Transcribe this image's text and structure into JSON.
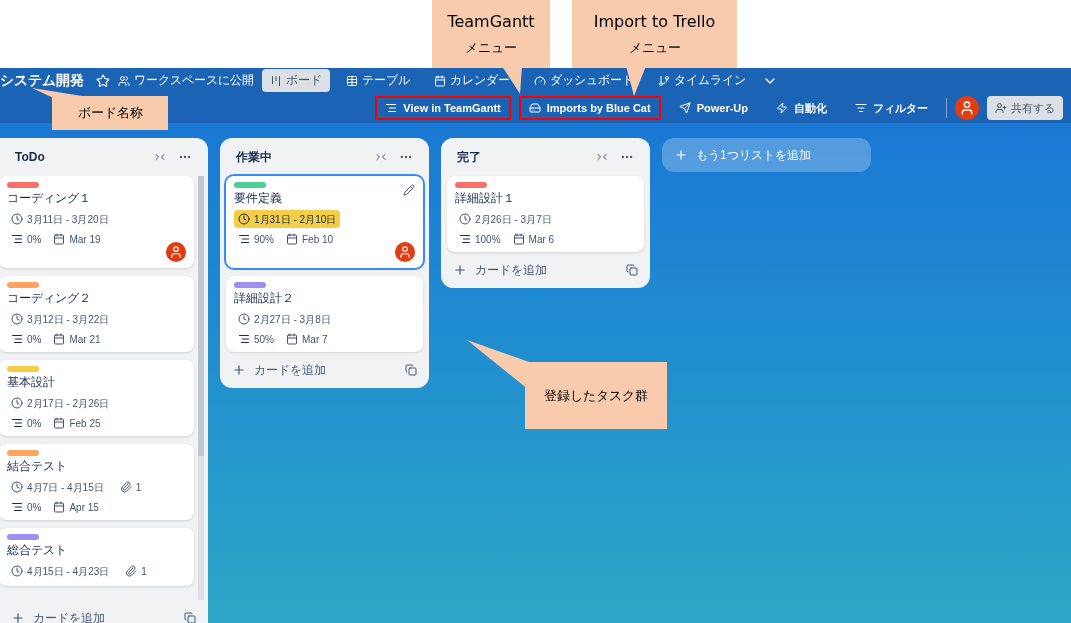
{
  "board": {
    "title": "システム開発",
    "visibility": "ワークスペースに公開"
  },
  "views": [
    {
      "label": "ボード",
      "selected": true
    },
    {
      "label": "テーブル",
      "selected": false
    },
    {
      "label": "カレンダー",
      "selected": false
    },
    {
      "label": "ダッシュボード",
      "selected": false
    },
    {
      "label": "タイムライン",
      "selected": false
    }
  ],
  "toolbar": [
    {
      "label": "View in TeamGantt",
      "highlighted": true
    },
    {
      "label": "Imports by Blue Cat",
      "highlighted": true
    },
    {
      "label": "Power-Up",
      "highlighted": false
    },
    {
      "label": "自動化",
      "highlighted": false
    },
    {
      "label": "フィルター",
      "highlighted": false
    }
  ],
  "share": "共有する",
  "lists": [
    {
      "title": "ToDo",
      "add_card": "カードを追加",
      "cards": [
        {
          "color": "#f87168",
          "title": "コーディング１",
          "dates": "3月11日 - 3月20日",
          "due_soon": false,
          "progress": "0%",
          "due": "Mar 19",
          "member": true,
          "focused": false
        },
        {
          "color": "#fea362",
          "title": "コーディング２",
          "dates": "3月12日 - 3月22日",
          "due_soon": false,
          "progress": "0%",
          "due": "Mar 21",
          "member": false,
          "focused": false
        },
        {
          "color": "#f5cd47",
          "title": "基本設計",
          "dates": "2月17日 - 2月26日",
          "due_soon": false,
          "progress": "0%",
          "due": "Feb 25",
          "member": false,
          "focused": false
        },
        {
          "color": "#fea362",
          "title": "結合テスト",
          "dates": "4月7日 - 4月15日",
          "due_soon": false,
          "attachments": "1",
          "progress": "0%",
          "due": "Apr 15",
          "member": false,
          "focused": false
        },
        {
          "color": "#9f8fef",
          "title": "総合テスト",
          "dates": "4月15日 - 4月23日",
          "due_soon": false,
          "attachments": "1",
          "member": false,
          "focused": false
        }
      ]
    },
    {
      "title": "作業中",
      "add_card": "カードを追加",
      "cards": [
        {
          "color": "#4bce97",
          "title": "要件定義",
          "dates": "1月31日 - 2月10日",
          "due_soon": true,
          "progress": "90%",
          "due": "Feb 10",
          "member": true,
          "focused": true
        },
        {
          "color": "#9f8fef",
          "title": "詳細設計２",
          "dates": "2月27日 - 3月8日",
          "due_soon": false,
          "progress": "50%",
          "due": "Mar 7",
          "member": false,
          "focused": false
        }
      ]
    },
    {
      "title": "完了",
      "add_card": "カードを追加",
      "cards": [
        {
          "color": "#f87168",
          "title": "詳細設計１",
          "dates": "2月26日 - 3月7日",
          "due_soon": false,
          "progress": "100%",
          "due": "Mar 6",
          "member": false,
          "focused": false
        }
      ]
    }
  ],
  "add_list": "もう1つリストを追加",
  "callouts": [
    {
      "kind": "teamgantt",
      "lines": [
        "TeamGantt",
        "メニュー"
      ]
    },
    {
      "kind": "import",
      "lines": [
        "Import to Trello",
        "メニュー"
      ]
    },
    {
      "kind": "board",
      "lines": [
        "ボード名称"
      ]
    },
    {
      "kind": "tasks",
      "lines": [
        "登録したタスク群"
      ]
    }
  ]
}
